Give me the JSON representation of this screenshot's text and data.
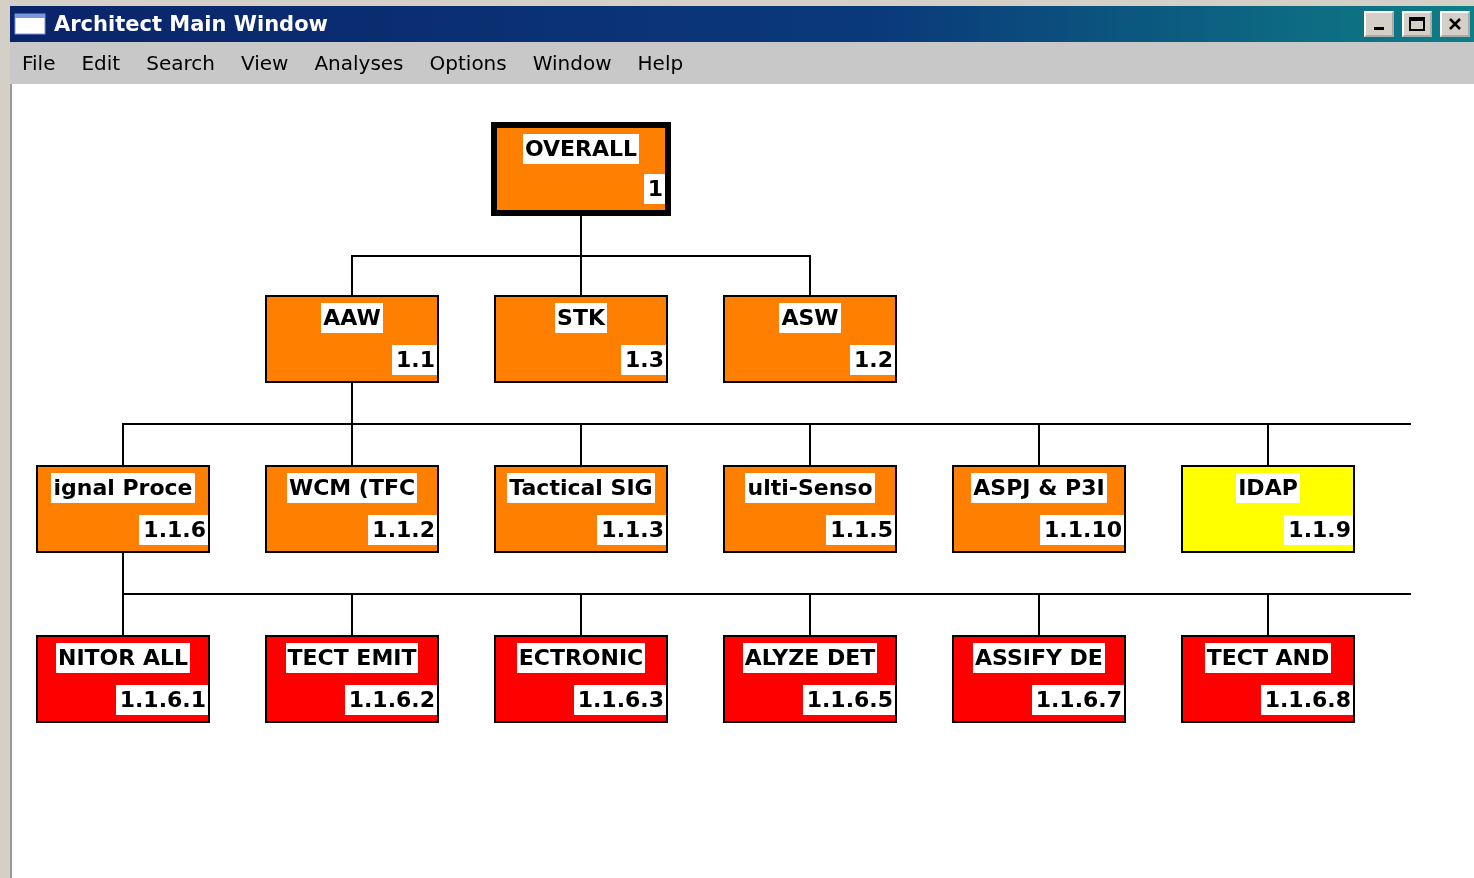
{
  "window": {
    "title": "Architect Main Window"
  },
  "menu": [
    "File",
    "Edit",
    "Search",
    "View",
    "Analyses",
    "Options",
    "Window",
    "Help"
  ],
  "tree": {
    "label": "OVERALL",
    "number": "1",
    "color": "#ff8000",
    "selected": true,
    "children": [
      {
        "label": "AAW",
        "number": "1.1",
        "color": "#ff8000",
        "selected": false,
        "children_continue": true,
        "children": [
          {
            "label": "ignal Proce",
            "number": "1.1.6",
            "color": "#ff8000",
            "selected": false,
            "children_continue": true,
            "children": [
              {
                "label": "NITOR ALL",
                "number": "1.1.6.1",
                "color": "#ff0000",
                "selected": false
              },
              {
                "label": "TECT EMIT",
                "number": "1.1.6.2",
                "color": "#ff0000",
                "selected": false
              },
              {
                "label": "ECTRONIC",
                "number": "1.1.6.3",
                "color": "#ff0000",
                "selected": false
              },
              {
                "label": "ALYZE DET",
                "number": "1.1.6.5",
                "color": "#ff0000",
                "selected": false
              },
              {
                "label": "ASSIFY DE",
                "number": "1.1.6.7",
                "color": "#ff0000",
                "selected": false
              },
              {
                "label": "TECT AND",
                "number": "1.1.6.8",
                "color": "#ff0000",
                "selected": false
              }
            ]
          },
          {
            "label": "WCM (TFC",
            "number": "1.1.2",
            "color": "#ff8000",
            "selected": false
          },
          {
            "label": "Tactical SIG",
            "number": "1.1.3",
            "color": "#ff8000",
            "selected": false
          },
          {
            "label": "ulti-Senso",
            "number": "1.1.5",
            "color": "#ff8000",
            "selected": false
          },
          {
            "label": "ASPJ & P3I",
            "number": "1.1.10",
            "color": "#ff8000",
            "selected": false
          },
          {
            "label": "IDAP",
            "number": "1.1.9",
            "color": "#ffff00",
            "selected": false
          }
        ]
      },
      {
        "label": "STK",
        "number": "1.3",
        "color": "#ff8000",
        "selected": false
      },
      {
        "label": "ASW",
        "number": "1.2",
        "color": "#ff8000",
        "selected": false
      }
    ]
  }
}
